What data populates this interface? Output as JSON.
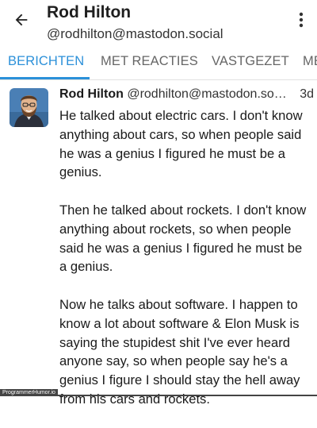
{
  "header": {
    "title": "Rod Hilton",
    "subtitle": "@rodhilton@mastodon.social",
    "back_icon": "arrow-left-icon",
    "menu_icon": "more-vertical-icon"
  },
  "tabs": [
    {
      "label": "BERICHTEN",
      "active": true
    },
    {
      "label": "MET REACTIES",
      "active": false
    },
    {
      "label": "VASTGEZET",
      "active": false
    },
    {
      "label": "ME",
      "active": false
    }
  ],
  "post": {
    "author": "Rod Hilton",
    "handle": "@rodhilton@mastodon.so…",
    "time": "3d",
    "paragraphs": [
      "He talked about electric cars. I don't know anything about cars, so when people said he was a genius I figured he must be a genius.",
      "Then he talked about rockets. I don't know anything about rockets, so when people said he was a genius I figured he must be a genius.",
      "Now he talks about software. I happen to know a lot about software & Elon Musk is saying the stupidest shit I've ever heard anyone say, so when people say he's a genius I figure I should stay the hell away from his cars and rockets."
    ]
  },
  "watermark": "ProgrammerHumor.io",
  "colors": {
    "accent": "#2b90d9",
    "text": "#1a1a1a"
  }
}
